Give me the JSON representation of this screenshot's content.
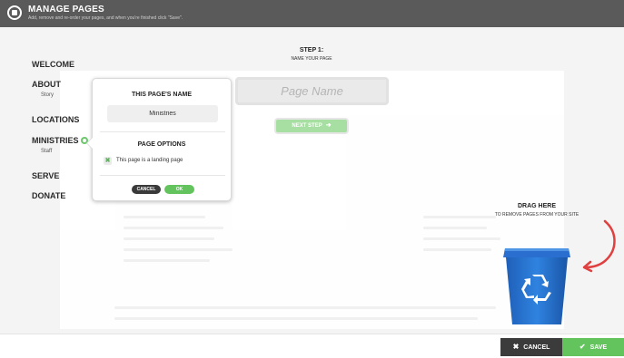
{
  "header": {
    "title": "MANAGE PAGES",
    "subtitle": "Add, remove and re-order your pages, and when you're finished click \"Save\"."
  },
  "nav": {
    "items": [
      {
        "label": "WELCOME"
      },
      {
        "label": "ABOUT",
        "sub": "Story"
      },
      {
        "label": "LOCATIONS"
      },
      {
        "label": "MINISTRIES",
        "sub": "Staff",
        "icon": "gear-icon"
      },
      {
        "label": "SERVE"
      },
      {
        "label": "DONATE"
      }
    ]
  },
  "step": {
    "title": "STEP 1:",
    "subtitle": "NAME YOUR PAGE",
    "input_placeholder": "Page Name",
    "next_label": "NEXT STEP",
    "next_icon": "arrow-right-icon"
  },
  "popup": {
    "name_heading": "THIS PAGE'S NAME",
    "name_value": "Ministries",
    "options_heading": "PAGE OPTIONS",
    "landing_label": "This page is a landing page",
    "landing_checked_mark": "✖",
    "cancel_label": "CANCEL",
    "ok_label": "OK"
  },
  "trash": {
    "title": "DRAG HERE",
    "subtitle": "TO REMOVE PAGES FROM YOUR SITE",
    "icon": "recycle-bin-icon",
    "color": "#1e6fd0"
  },
  "footer": {
    "cancel_label": "CANCEL",
    "cancel_icon": "✖",
    "save_label": "SAVE",
    "save_icon": "✔"
  },
  "colors": {
    "header": "#5a5a5a",
    "accent_green": "#63c45e",
    "dark_button": "#3b3b3b",
    "arrow_red": "#e04040"
  }
}
